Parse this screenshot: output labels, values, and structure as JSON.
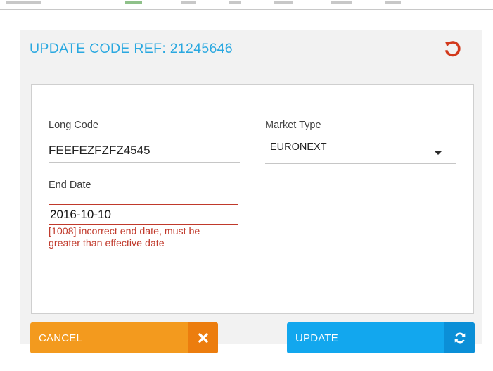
{
  "colors": {
    "accent_title": "#29a8e0",
    "reset_icon": "#d2391c",
    "error": "#c0392b",
    "cancel_bg": "#f39a1e",
    "cancel_icon_bg": "#ec7d0e",
    "update_bg": "#12a7ee",
    "update_icon_bg": "#0b8fd7",
    "panel_bg": "#f2f2f2"
  },
  "dialog": {
    "title": "UPDATE CODE REF: 21245646",
    "reset_icon": "reset-undo-icon"
  },
  "form": {
    "long_code": {
      "label": "Long Code",
      "value": "FEEFEZFZFZ4545"
    },
    "market_type": {
      "label": "Market Type",
      "value": "EURONEXT",
      "icon": "caret-down-icon"
    },
    "end_date": {
      "label": "End Date",
      "value": "2016-10-10",
      "error_line1": "[1008] incorrect end date, must be",
      "error_line2": "greater than effective date"
    }
  },
  "actions": {
    "cancel": {
      "label": "CANCEL",
      "icon": "close-x-icon"
    },
    "update": {
      "label": "UPDATE",
      "icon": "refresh-icon"
    }
  }
}
